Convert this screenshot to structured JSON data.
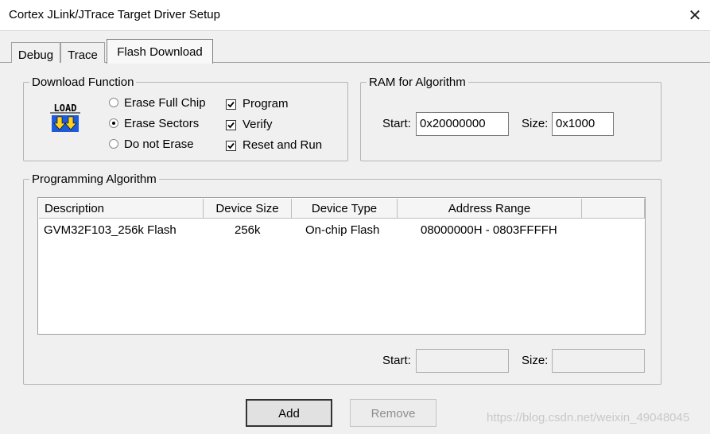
{
  "window": {
    "title": "Cortex JLink/JTrace Target Driver Setup",
    "close_glyph": "✕"
  },
  "tabs": [
    {
      "label": "Debug"
    },
    {
      "label": "Trace"
    },
    {
      "label": "Flash Download"
    }
  ],
  "download_function": {
    "label": "Download Function",
    "icon_text": "LOAD",
    "radios": [
      {
        "label": "Erase Full Chip",
        "selected": false
      },
      {
        "label": "Erase Sectors",
        "selected": true
      },
      {
        "label": "Do not Erase",
        "selected": false
      }
    ],
    "checkboxes": [
      {
        "label": "Program",
        "checked": true
      },
      {
        "label": "Verify",
        "checked": true
      },
      {
        "label": "Reset and Run",
        "checked": true
      }
    ]
  },
  "ram": {
    "label": "RAM for Algorithm",
    "start_label": "Start:",
    "start_value": "0x20000000",
    "size_label": "Size:",
    "size_value": "0x1000"
  },
  "programming": {
    "label": "Programming Algorithm",
    "columns": [
      "Description",
      "Device Size",
      "Device Type",
      "Address Range"
    ],
    "rows": [
      [
        "GVM32F103_256k Flash",
        "256k",
        "On-chip Flash",
        "08000000H - 0803FFFFH"
      ]
    ],
    "start_label": "Start:",
    "start_value": "",
    "size_label": "Size:",
    "size_value": ""
  },
  "buttons": {
    "add": "Add",
    "remove": "Remove"
  },
  "watermark": "https://blog.csdn.net/weixin_49048045"
}
